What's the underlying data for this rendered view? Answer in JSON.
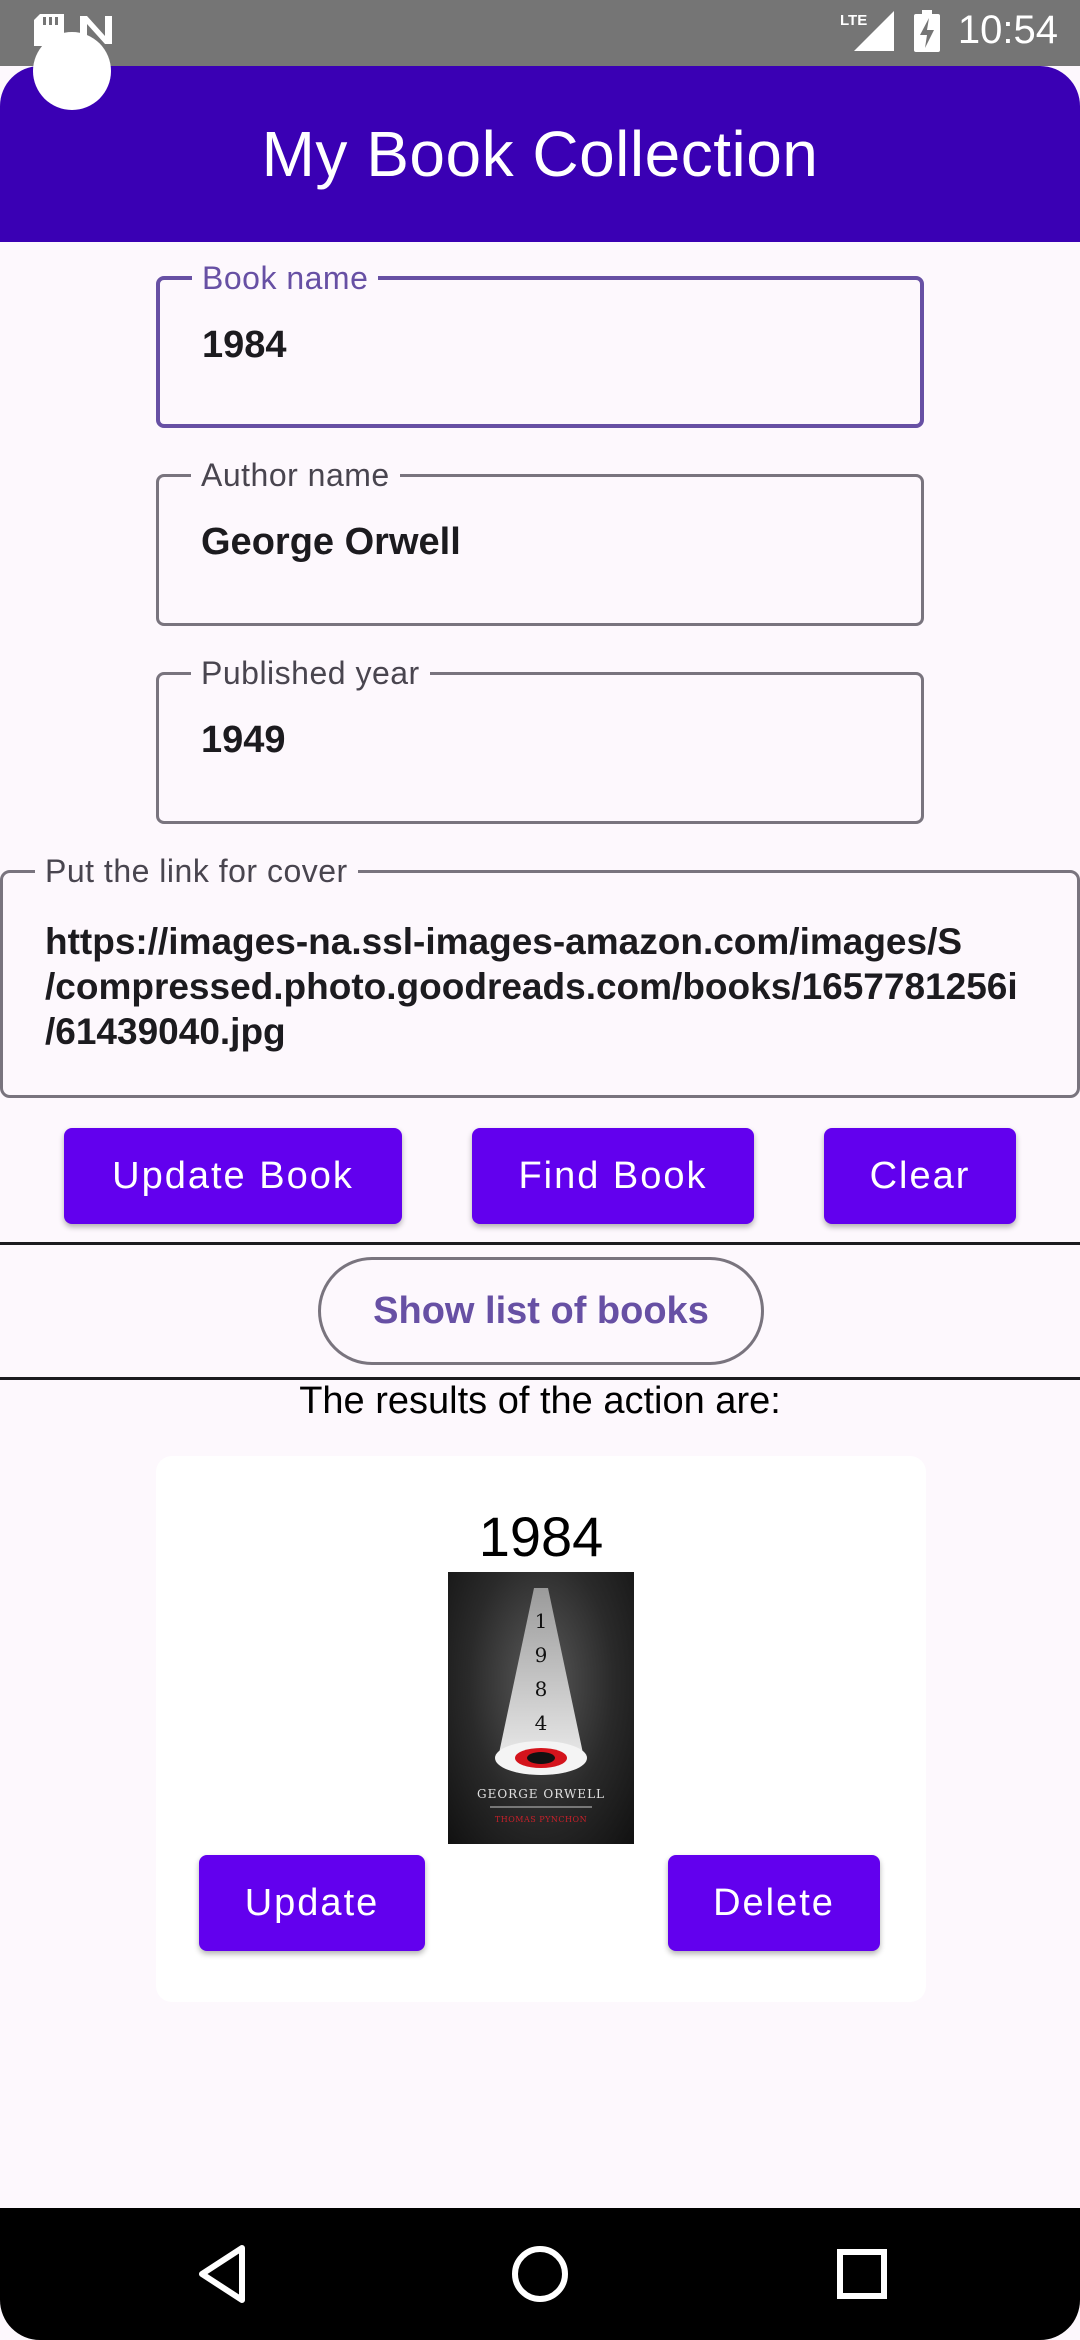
{
  "status_bar": {
    "time": "10:54",
    "network": "LTE",
    "icons": [
      "sd-card-icon",
      "n-notification-icon",
      "lte-signal-icon",
      "battery-charging-icon"
    ]
  },
  "app_bar": {
    "title": "My Book Collection"
  },
  "form": {
    "book_name": {
      "label": "Book name",
      "value": "1984"
    },
    "author_name": {
      "label": "Author name",
      "value": "George Orwell"
    },
    "published_year": {
      "label": "Published year",
      "value": "1949"
    },
    "cover_link": {
      "label": "Put the link for cover",
      "value": "https://images-na.ssl-images-amazon.com/images/S\n/compressed.photo.goodreads.com/books/1657781256i\n/61439040.jpg"
    }
  },
  "actions": {
    "update_book": "Update Book",
    "find_book": "Find Book",
    "clear": "Clear",
    "show_list": "Show list of books"
  },
  "results": {
    "label": "The results of the action are:",
    "book": {
      "title": "1984",
      "cover_text": {
        "digits": [
          "1",
          "9",
          "8",
          "4"
        ],
        "author": "GEORGE ORWELL",
        "subtitle": "THOMAS PYNCHON"
      },
      "update_label": "Update",
      "delete_label": "Delete"
    }
  },
  "nav_bar": {
    "icons": [
      "back-icon",
      "home-icon",
      "recents-icon"
    ]
  },
  "colors": {
    "app_bar": "#3a00b4",
    "button": "#6200ee",
    "focus": "#6750a4",
    "status_bar": "#757575"
  }
}
